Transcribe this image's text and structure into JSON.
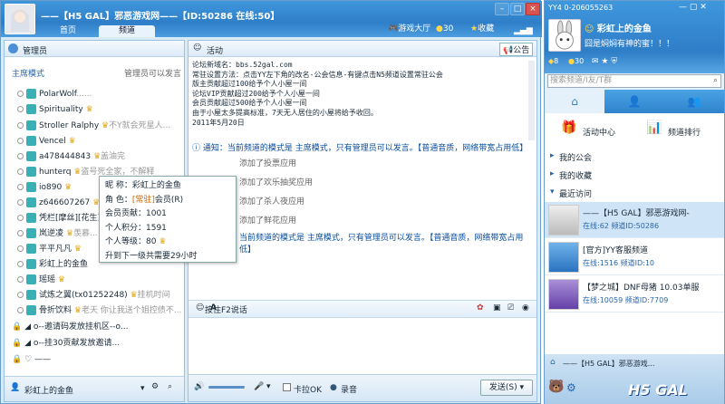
{
  "window": {
    "title": "——【H5 GAL】邪恶游戏网——【ID:50286 在线:50】",
    "tabs": [
      {
        "label": "首页"
      },
      {
        "label": "频道"
      }
    ],
    "lobby_label": "游戏大厅",
    "coins": "30",
    "favorite_label": "收藏"
  },
  "left": {
    "header": "管理员",
    "mode": "主席模式",
    "mode_note": "管理员可以发言",
    "members": [
      {
        "name": "PolarWolf",
        "note": "......"
      },
      {
        "name": "Spirituality",
        "note": ""
      },
      {
        "name": "Stroller Ralphy",
        "note": "不Y就会死星人..."
      },
      {
        "name": "Vencel",
        "note": ""
      },
      {
        "name": "a478444843",
        "note": "盖油完"
      },
      {
        "name": "hunterq",
        "note": "盗号死全家，不解释"
      },
      {
        "name": "io890",
        "note": ""
      },
      {
        "name": "z646607267",
        "note": ""
      },
      {
        "name": "凭栏[摩丝][花生]",
        "note": ""
      },
      {
        "name": "岚逆凌",
        "note": "羡慕..."
      },
      {
        "name": "平平凡凡",
        "note": ""
      },
      {
        "name": "彩虹上的金鱼",
        "note": ""
      },
      {
        "name": "瑶瑶",
        "note": ""
      },
      {
        "name": "试炼之翼(tx01252248)",
        "note": "挂机时间"
      },
      {
        "name": "骨折饮料",
        "note": "老天 你让我送个姐控债不..."
      }
    ],
    "channels": [
      {
        "name": "o--邀请码发放挂机区--o..."
      },
      {
        "name": "o--挂30贡献发放邀请..."
      },
      {
        "name": "——"
      }
    ],
    "footer_user": "彩虹上的金鱼"
  },
  "tooltip": {
    "nick_label": "昵   称：",
    "nick": "彩虹上的金鱼",
    "role_label": "角   色：",
    "role_tag": "[常驻]",
    "role": "会员(R)",
    "contrib": "会员贡献：1001",
    "points": "个人积分：1591",
    "level": "个人等级：80",
    "upgrade": "升到下一级共需要29小时"
  },
  "main": {
    "header": "活动",
    "notice_label": "公告",
    "board": [
      "论坛新域名：bbs.52gal.com",
      "常驻设置方法：点击YY左下角的改名-公会信息-有键点击N5频道设置常驻公会",
      "版主贡献超过100给予个人小屋一间",
      "论坛VIP贡献超过200给予个人小屋一间",
      "会员贡献超过500给予个人小屋一间",
      "由于小屋太多提高标准，7天无人居住的小屋将给予收回。",
      "2011年5月20日"
    ],
    "chat": [
      {
        "kind": "info",
        "text": "通知：当前频道的模式是 主席模式，只有管理员可以发言。【普通音质，网络带宽占用低】"
      },
      {
        "kind": "sys",
        "text": "添加了投票应用"
      },
      {
        "kind": "sys",
        "text": "添加了欢乐抽奖应用"
      },
      {
        "kind": "sys",
        "text": "添加了杀人夜应用"
      },
      {
        "kind": "sys",
        "text": "添加了鲜花应用"
      },
      {
        "kind": "info",
        "text": "当前频道的模式是 主席模式，只有管理员可以发言。【普通音质，网络带宽占用低】"
      }
    ],
    "ptt_label": "按住F2说话",
    "karaoke_label": "卡拉OK",
    "record_label": "录音",
    "send_label": "发送(S)"
  },
  "right": {
    "yy_id": "YY4 0-206055263",
    "nick": "彩虹上的金鱼",
    "signature": "囧是焖焖有神的蜜！！！",
    "level": "8",
    "coins": "30",
    "search_placeholder": "搜索频道/I友/T群",
    "activity": "活动中心",
    "rank": "频道排行",
    "my_guild": "我的公会",
    "my_fav": "我的收藏",
    "recent": "最近访问",
    "recent_items": [
      {
        "name": "——【H5 GAL】邪恶游戏网-",
        "online_label": "在线:",
        "online": "62",
        "id_label": "频道ID:",
        "id": "50286"
      },
      {
        "name": "[官方]YY客服频道",
        "online_label": "在线:",
        "online": "1516",
        "id_label": "频道ID:",
        "id": "10"
      },
      {
        "name": "【梦之城】DNF母猪 10.03单服",
        "online_label": "在线:",
        "online": "10059",
        "id_label": "频道ID:",
        "id": "7709"
      }
    ],
    "bottom_logo": "H5 GAL",
    "bottom_text": "——【H5 GAL】邪恶游戏..."
  }
}
